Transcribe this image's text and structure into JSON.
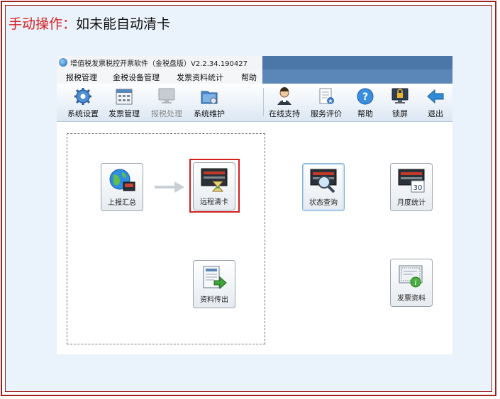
{
  "headline": {
    "prefix": "手动操作：",
    "text": "如未能自动清卡"
  },
  "window": {
    "title": "增值税发票税控开票软件（金税盘版）V2.2.34.190427"
  },
  "menu": [
    "报税管理",
    "金税设备管理",
    "发票资料统计",
    "帮助"
  ],
  "toolbar": {
    "left": [
      {
        "label": "系统设置",
        "icon": "gear-icon"
      },
      {
        "label": "发票管理",
        "icon": "invoice-management-icon"
      },
      {
        "label": "报税处理",
        "icon": "monitor-icon",
        "disabled": true
      },
      {
        "label": "系统维护",
        "icon": "folder-settings-icon"
      }
    ],
    "right": [
      {
        "label": "在线支持",
        "icon": "support-person-icon"
      },
      {
        "label": "服务评价",
        "icon": "document-rating-icon"
      },
      {
        "label": "帮助",
        "icon": "help-icon"
      },
      {
        "label": "锁屏",
        "icon": "lock-screen-icon"
      },
      {
        "label": "退出",
        "icon": "exit-arrow-icon"
      }
    ]
  },
  "tiles": {
    "upload_summary": "上报汇总",
    "remote_clear": "远程清卡",
    "data_export": "资料传出",
    "status_query": "状态查询",
    "monthly_stats": "月度统计",
    "invoice_data": "发票资料"
  },
  "calendar_day": "30",
  "colors": {
    "highlight": "#d42020",
    "frame": "#a02020",
    "titlebar": "#4a76a8"
  }
}
